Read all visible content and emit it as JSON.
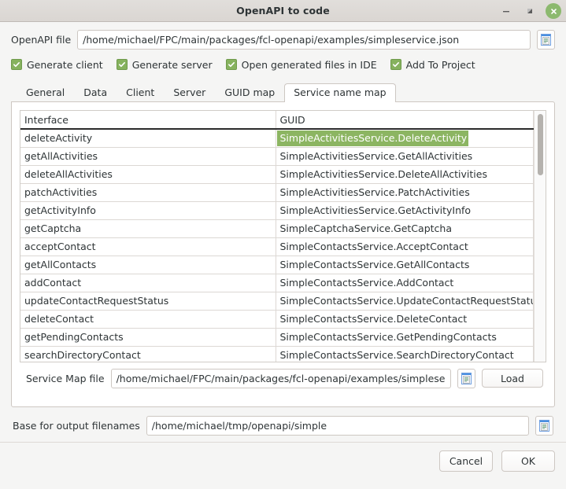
{
  "window": {
    "title": "OpenAPI to code",
    "minimize_label": "minimize-icon",
    "maximize_label": "restore-icon",
    "close_label": "close-icon",
    "close_color": "#8cb96e"
  },
  "openapi_file": {
    "label": "OpenAPI file",
    "value": "/home/michael/FPC/main/packages/fcl-openapi/examples/simpleservice.json",
    "placeholder": "",
    "browse_icon": "document-icon"
  },
  "options": [
    {
      "label": "Generate client",
      "checked": true
    },
    {
      "label": "Generate server",
      "checked": true
    },
    {
      "label": "Open generated files in IDE",
      "checked": true
    },
    {
      "label": "Add To Project",
      "checked": true
    }
  ],
  "tabs": [
    {
      "label": "General",
      "active": false
    },
    {
      "label": "Data",
      "active": false
    },
    {
      "label": "Client",
      "active": false
    },
    {
      "label": "Server",
      "active": false
    },
    {
      "label": "GUID map",
      "active": false
    },
    {
      "label": "Service name map",
      "active": true
    }
  ],
  "grid": {
    "columns": [
      "Interface",
      "GUID"
    ],
    "selected_row": 0,
    "selected_column": 1,
    "selection_color": "#8cb562",
    "rows": [
      {
        "interface": "deleteActivity",
        "guid": "SimpleActivitiesService.DeleteActivity"
      },
      {
        "interface": "getAllActivities",
        "guid": "SimpleActivitiesService.GetAllActivities"
      },
      {
        "interface": "deleteAllActivities",
        "guid": "SimpleActivitiesService.DeleteAllActivities"
      },
      {
        "interface": "patchActivities",
        "guid": "SimpleActivitiesService.PatchActivities"
      },
      {
        "interface": "getActivityInfo",
        "guid": "SimpleActivitiesService.GetActivityInfo"
      },
      {
        "interface": "getCaptcha",
        "guid": "SimpleCaptchaService.GetCaptcha"
      },
      {
        "interface": "acceptContact",
        "guid": "SimpleContactsService.AcceptContact"
      },
      {
        "interface": "getAllContacts",
        "guid": "SimpleContactsService.GetAllContacts"
      },
      {
        "interface": "addContact",
        "guid": "SimpleContactsService.AddContact"
      },
      {
        "interface": "updateContactRequestStatus",
        "guid": "SimpleContactsService.UpdateContactRequestStatus"
      },
      {
        "interface": "deleteContact",
        "guid": "SimpleContactsService.DeleteContact"
      },
      {
        "interface": "getPendingContacts",
        "guid": "SimpleContactsService.GetPendingContacts"
      },
      {
        "interface": "searchDirectoryContact",
        "guid": "SimpleContactsService.SearchDirectoryContact"
      }
    ]
  },
  "service_map": {
    "label": "Service Map file",
    "value": "/home/michael/FPC/main/packages/fcl-openapi/examples/simpleservic",
    "browse_icon": "document-icon",
    "load_label": "Load"
  },
  "base_output": {
    "label": "Base for output filenames",
    "value": "/home/michael/tmp/openapi/simple",
    "browse_icon": "document-icon"
  },
  "footer": {
    "cancel_label": "Cancel",
    "ok_label": "OK"
  }
}
